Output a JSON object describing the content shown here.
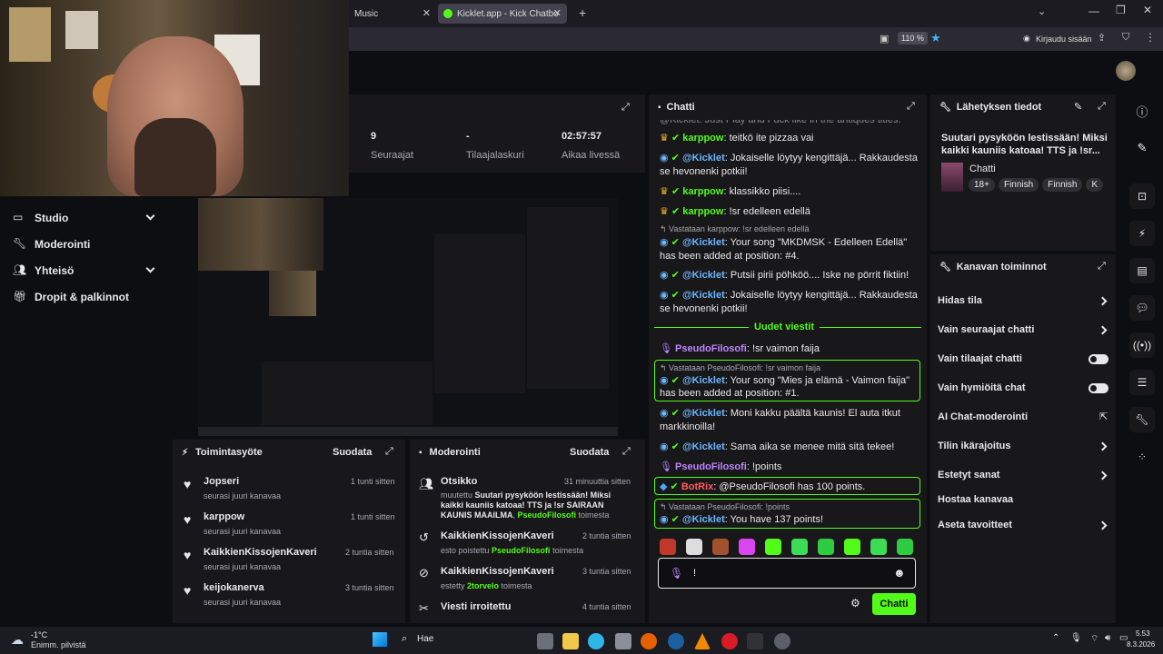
{
  "browser": {
    "tab1": "Music",
    "tab2": "Kicklet.app - Kick Chatbot and C",
    "zoom": "110 %",
    "signin": "Kirjaudu sisään"
  },
  "stats": [
    {
      "value": "9",
      "label": "Seuraajat"
    },
    {
      "value": "-",
      "label": "Tilaajalaskuri"
    },
    {
      "value": "02:57:57",
      "label": "Aikaa livessä"
    }
  ],
  "sidebar": [
    {
      "label": "Studio",
      "chevron": true
    },
    {
      "label": "Moderointi",
      "chevron": false
    },
    {
      "label": "Yhteisö",
      "chevron": true
    },
    {
      "label": "Dropit & palkinnot",
      "chevron": false
    }
  ],
  "activity": {
    "title": "Toimintasyöte",
    "filter": "Suodata",
    "items": [
      {
        "name": "Jopseri",
        "sub": "seurasi juuri kanavaa",
        "time": "1 tunti sitten"
      },
      {
        "name": "karppow",
        "sub": "seurasi juuri kanavaa",
        "time": "1 tunti sitten"
      },
      {
        "name": "KaikkienKissojenKaveri",
        "sub": "seurasi juuri kanavaa",
        "time": "2 tuntia sitten"
      },
      {
        "name": "keijokanerva",
        "sub": "seurasi juuri kanavaa",
        "time": "3 tuntia sitten"
      }
    ]
  },
  "moderation": {
    "title": "Moderointi",
    "filter": "Suodata",
    "items": [
      {
        "name": "Otsikko",
        "time": "31 minuuttia sitten",
        "line1_pre": "muutettu ",
        "line1_bold": "Suutari pysyköön lestissään! Miksi kaikki kauniis katoaa! TTS ja !sr SAIRAAN KAUNIS MAAILMA",
        "line1_sep": ", ",
        "line1_user": "PseudoFilosofi",
        "line1_post": " toimesta"
      },
      {
        "name": "KaikkienKissojenKaveri",
        "time": "2 tuntia sitten",
        "pre": "esto poistettu ",
        "user": "PseudoFilosofi",
        "post": " toimesta"
      },
      {
        "name": "KaikkienKissojenKaveri",
        "time": "3 tuntia sitten",
        "pre": "estetty ",
        "user": "2torvelo",
        "post": " toimesta"
      },
      {
        "name": "Viesti irroitettu",
        "time": "4 tuntia sitten"
      }
    ]
  },
  "chat": {
    "title": "Chatti",
    "top_partial": "@Kicklet: Just Play and Fuck like in the antiques titles.",
    "msg1_user": "karppow",
    "msg1_text": ": teitkö ite pizzaa vai",
    "msg2_user": "@Kicklet",
    "msg2_text": ": Jokaiselle löytyy kengittäjä... Rakkaudesta se hevonenki potkii!",
    "msg3_user": "karppow",
    "msg3_text": ": klassikko piisi....",
    "msg4_user": "karppow",
    "msg4_text": ": !sr edelleen edellä",
    "msg5_reply": "Vastataan karppow: !sr edelleen edellä",
    "msg5_user": "@Kicklet",
    "msg5_text": ": Your song \"MKDMSK - Edelleen Edellä\" has been added at position: #4.",
    "msg6_user": "@Kicklet",
    "msg6_text": ": Putsii pirii pöhköö.... Iske ne pörrit fiktiin!",
    "msg7_user": "@Kicklet",
    "msg7_text": ": Jokaiselle löytyy kengittäjä... Rakkaudesta se hevonenki potkii!",
    "divider": "Uudet viestit",
    "msg8_user": "PseudoFilosofi",
    "msg8_text": ": !sr vaimon faija",
    "msg9_reply": "Vastataan PseudoFilosofi: !sr vaimon faija",
    "msg9_user": "@Kicklet",
    "msg9_text": ": Your song \"Mies ja elämä - Vaimon faija\" has been added at position: #1.",
    "msg10_user": "@Kicklet",
    "msg10_text": ": Moni kakku päältä kaunis! El auta itkut markkinoilla!",
    "msg11_user": "@Kicklet",
    "msg11_text": ": Sama aika se menee mitä sitä tekee!",
    "msg12_user": "PseudoFilosofi",
    "msg12_text": ": !points",
    "msg13_user": "BotRix",
    "msg13_text": ": @PseudoFilosofi has 100 points.",
    "msg14_reply": "Vastataan PseudoFilosofi: !points",
    "msg14_user": "@Kicklet",
    "msg14_text": ": You have 137 points!",
    "input_value": "!",
    "send": "Chatti"
  },
  "stream_info": {
    "title": "Lähetyksen tiedot",
    "stream_title": "Suutari pysyköön lestissään! Miksi kaikki kauniis katoaa! TTS ja !sr...",
    "category": "Chatti",
    "tags": [
      "18+",
      "Finnish",
      "Finnish",
      "K"
    ]
  },
  "channel_actions": {
    "title": "Kanavan toiminnot",
    "items": [
      {
        "label": "Hidas tila",
        "type": "chevron"
      },
      {
        "label": "Vain seuraajat chatti",
        "type": "chevron"
      },
      {
        "label": "Vain tilaajat chatti",
        "type": "toggle"
      },
      {
        "label": "Vain hymiöitä chat",
        "type": "toggle"
      },
      {
        "label": "AI Chat-moderointi",
        "type": "external"
      },
      {
        "label": "Tilin ikärajoitus",
        "type": "chevron"
      },
      {
        "label": "Estetyt sanat",
        "type": "chevron"
      },
      {
        "label": "Hostaa kanavaa",
        "type": "none"
      },
      {
        "label": "Aseta tavoitteet",
        "type": "chevron"
      }
    ]
  },
  "taskbar": {
    "weather_temp": "-1°C",
    "weather_desc": "Enimm. pilvistä",
    "search": "Hae",
    "time": "5.53",
    "date": "8.3.2026"
  },
  "colors": {
    "accent": "#53fc18",
    "panel": "#18181b",
    "bg": "#0d0e12"
  }
}
